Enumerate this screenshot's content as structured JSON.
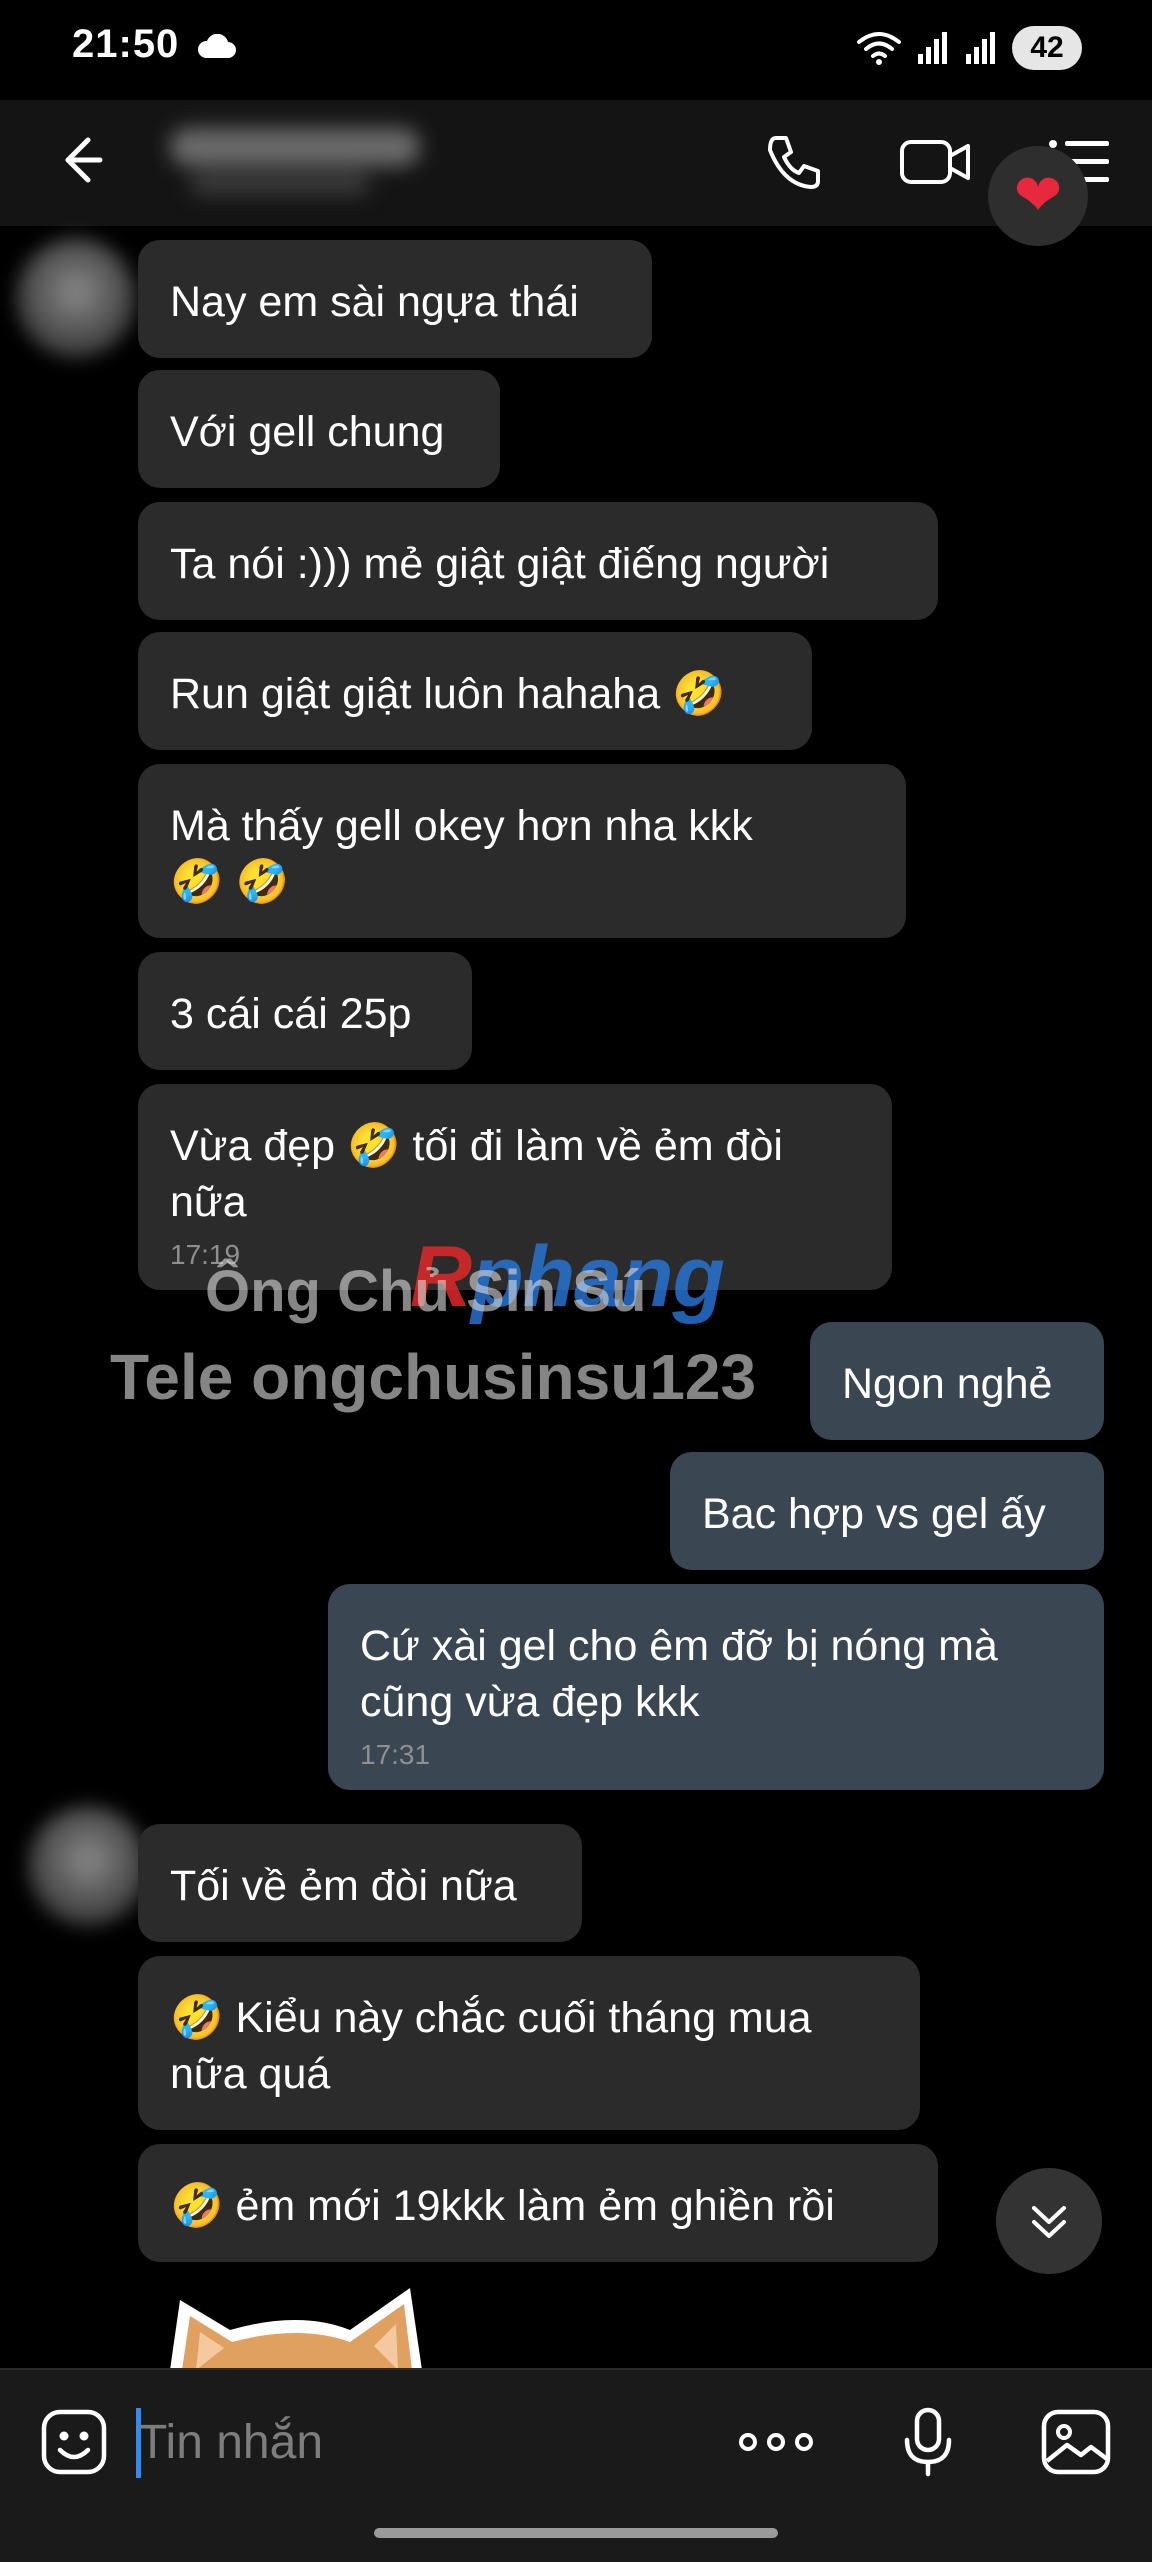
{
  "status_bar": {
    "time": "21:50",
    "battery": "42"
  },
  "header": {
    "contact_name": "",
    "heart_icon": "heart-emoji"
  },
  "messages": [
    {
      "dir": "in",
      "text": "Nay em sài ngựa thái"
    },
    {
      "dir": "in",
      "text": "Với gell chung"
    },
    {
      "dir": "in",
      "text": "Ta nói :))) mẻ giật giật điếng người"
    },
    {
      "dir": "in",
      "text": "Run giật giật luôn hahaha 🤣"
    },
    {
      "dir": "in",
      "text": "Mà thấy gell okey hơn nha kkk 🤣 🤣"
    },
    {
      "dir": "in",
      "text": "3 cái cái 25p"
    },
    {
      "dir": "in",
      "text": "Vừa đẹp 🤣 tối đi làm về ẻm đòi nữa",
      "time": "17:19"
    },
    {
      "dir": "out",
      "text": "Ngon nghẻ"
    },
    {
      "dir": "out",
      "text": "Bac hợp vs gel ấy"
    },
    {
      "dir": "out",
      "text": "Cứ xài gel cho êm đỡ bị nóng mà cũng vừa đẹp kkk",
      "time": "17:31"
    },
    {
      "dir": "in",
      "text": "Tối về ẻm đòi nữa"
    },
    {
      "dir": "in",
      "text": "🤣 Kiểu này chắc cuối tháng mua nữa quá"
    },
    {
      "dir": "in",
      "text": "🤣 ẻm mới 19kkk làm ẻm ghiền rồi"
    }
  ],
  "watermark": {
    "line1": "Ông Chủ Sin Sú",
    "line2": "Tele ongchusinsu123",
    "brand_r": "R",
    "brand_rest": "phang"
  },
  "composer": {
    "placeholder": "Tin nhắn"
  }
}
